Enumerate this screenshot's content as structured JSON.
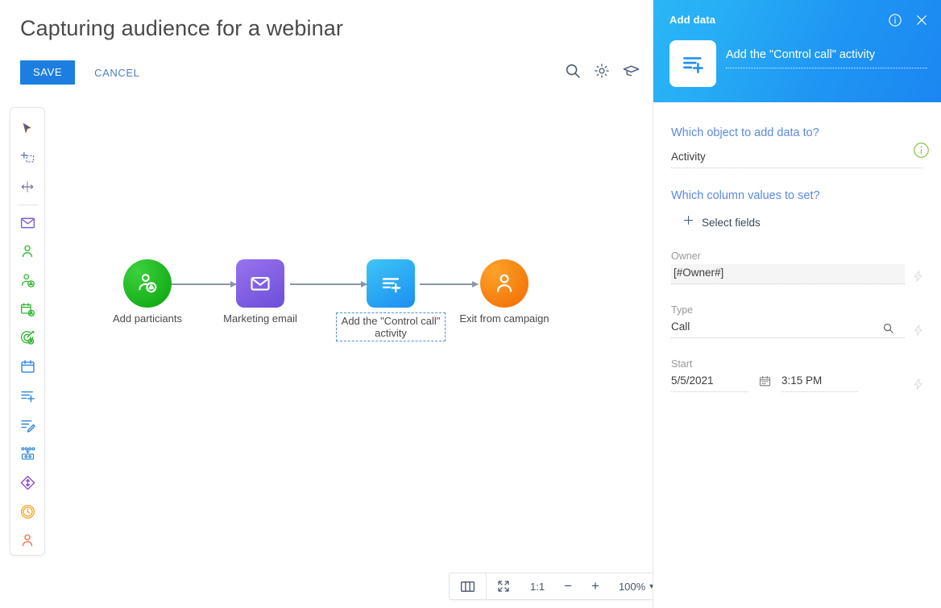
{
  "page": {
    "title": "Capturing audience for a webinar"
  },
  "actions": {
    "save_label": "SAVE",
    "cancel_label": "CANCEL"
  },
  "header_icons": [
    {
      "name": "search-icon",
      "label": "Search"
    },
    {
      "name": "gear-icon",
      "label": "Settings"
    },
    {
      "name": "graduation-cap-icon",
      "label": "Learning"
    }
  ],
  "left_toolbar": {
    "items": [
      {
        "name": "pointer-tool-icon",
        "label": "Select",
        "color": "#4a5a8c"
      },
      {
        "name": "add-selection-tool-icon",
        "label": "Add selection",
        "color": "#6b7aa8"
      },
      {
        "name": "move-tool-icon",
        "label": "Move",
        "color": "#6b7aa8"
      },
      {
        "name": "email-element-icon",
        "label": "Marketing email",
        "color": "#7b5fd6"
      },
      {
        "name": "add-participant-icon",
        "label": "Add participant",
        "color": "#2eb82e"
      },
      {
        "name": "participant-condition-icon",
        "label": "Participant condition",
        "color": "#2eb82e"
      },
      {
        "name": "calendar-event-icon",
        "label": "Event",
        "color": "#2eb82e"
      },
      {
        "name": "goal-target-icon",
        "label": "Goal",
        "color": "#2eb82e"
      },
      {
        "name": "calendar-icon",
        "label": "Calendar",
        "color": "#2f86d8"
      },
      {
        "name": "add-data-icon",
        "label": "Add data",
        "color": "#2f86d8"
      },
      {
        "name": "edit-data-icon",
        "label": "Edit data",
        "color": "#2f86d8"
      },
      {
        "name": "data-flow-icon",
        "label": "Data flow",
        "color": "#2f86d8"
      },
      {
        "name": "move-diamond-icon",
        "label": "Transition",
        "color": "#8a3fd1"
      },
      {
        "name": "timer-icon",
        "label": "Timer",
        "color": "#f5a623"
      },
      {
        "name": "exit-person-icon",
        "label": "Exit",
        "color": "#f5704a"
      }
    ]
  },
  "flow": {
    "nodes": [
      {
        "name": "node-add-participants",
        "label": "Add particiants",
        "icon": "add-participant-icon",
        "shape": "circle",
        "color_start": "#36c43a",
        "color_end": "#0aa30a",
        "selected": false
      },
      {
        "name": "node-marketing-email",
        "label": "Marketing email",
        "icon": "envelope-icon",
        "shape": "square",
        "color_start": "#8f66e8",
        "color_end": "#6a4fd8",
        "selected": false
      },
      {
        "name": "node-add-control-call",
        "label": "Add the \"Control call\" activity",
        "icon": "add-data-icon",
        "shape": "square",
        "color_start": "#38c0f5",
        "color_end": "#1b8ef0",
        "selected": true
      },
      {
        "name": "node-exit-campaign",
        "label": "Exit from campaign",
        "icon": "exit-person-icon",
        "shape": "circle",
        "color_start": "#fb9a1d",
        "color_end": "#f36a00",
        "selected": false
      }
    ]
  },
  "zoom_bar": {
    "panels_label": "panels-icon",
    "fit_label": "fit-screen-icon",
    "ratio_label": "1:1",
    "minus_label": "−",
    "plus_label": "+",
    "zoom_value": "100%",
    "caret_label": "▾"
  },
  "right_panel": {
    "header": {
      "title": "Add data",
      "activity_title": "Add the \"Control call\" activity",
      "info_icon": "info-icon",
      "close_icon": "close-icon"
    },
    "object_question": {
      "label": "Which object to add data to?",
      "value": "Activity",
      "info_icon": "info-icon"
    },
    "columns_question": {
      "label": "Which column values to set?",
      "select_fields_label": "Select fields"
    },
    "fields": [
      {
        "name": "owner",
        "label": "Owner",
        "value": "[#Owner#]",
        "filled": true,
        "has_search": false,
        "bolt_icon": "lightning-icon"
      },
      {
        "name": "type",
        "label": "Type",
        "value": "Call",
        "filled": false,
        "has_search": true,
        "bolt_icon": "lightning-icon"
      }
    ],
    "start_field": {
      "label": "Start",
      "date_value": "5/5/2021",
      "time_value": "3:15 PM",
      "calendar_icon": "calendar-icon",
      "bolt_icon": "lightning-icon"
    }
  },
  "colors": {
    "accent_blue": "#1b7ee0",
    "link_blue": "#5b8ade",
    "header_gradient_start": "#2ab6f6",
    "header_gradient_end": "#1b86f2",
    "green_info": "#8bc34a"
  }
}
